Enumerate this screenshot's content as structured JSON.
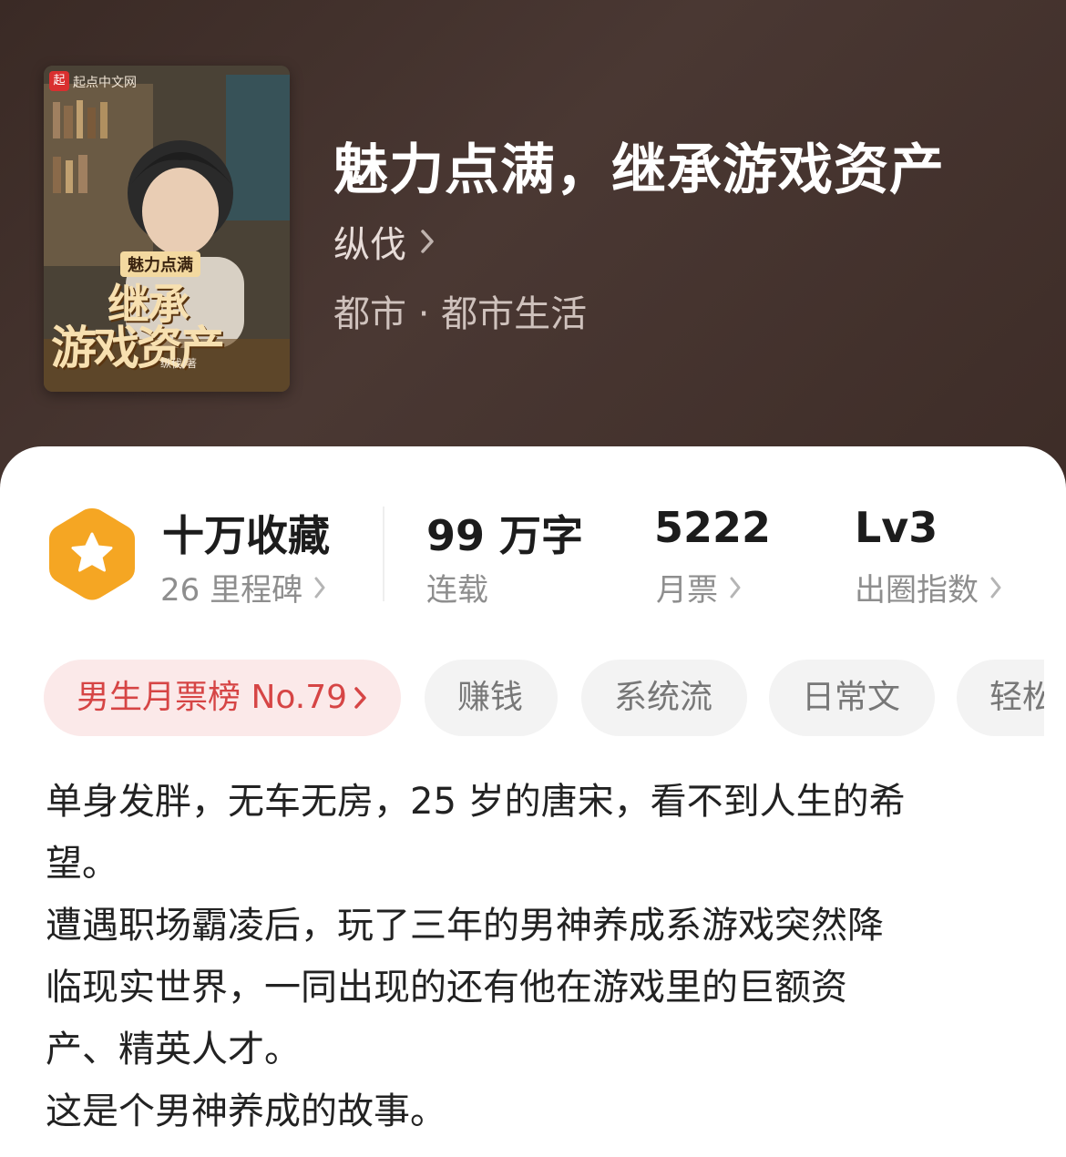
{
  "book": {
    "title": "魅力点满，继承游戏资产",
    "author": "纵伐",
    "genre": "都市 · 都市生活"
  },
  "cover": {
    "site_label": "起点中文网",
    "logo_char": "起",
    "title_small": "魅力点满",
    "title_line1": "继承",
    "title_line2": "游戏资产",
    "author_credit": "纵伐/著"
  },
  "stats": {
    "collection": {
      "value": "十万收藏",
      "sub": "26 里程碑"
    },
    "words": {
      "value": "99 万字",
      "sub": "连载"
    },
    "monthly_ticket": {
      "value": "5222",
      "sub": "月票"
    },
    "level": {
      "value": "Lv3",
      "sub": "出圈指数"
    }
  },
  "tags": [
    {
      "label": "男生月票榜 No.79"
    },
    {
      "label": "赚钱"
    },
    {
      "label": "系统流"
    },
    {
      "label": "日常文"
    },
    {
      "label": "轻松"
    }
  ],
  "description": [
    "单身发胖，无车无房，25 岁的唐宋，看不到人生的希",
    "望。",
    "遭遇职场霸凌后，玩了三年的男神养成系游戏突然降",
    "临现实世界，一同出现的还有他在游戏里的巨额资",
    "产、精英人才。",
    "这是个男神养成的故事。"
  ],
  "colors": {
    "header_bg": "#3f2e29",
    "badge_orange": "#f5a623",
    "rank_red": "#d64545"
  },
  "icons": [
    "star-badge-icon",
    "chevron-right-icon"
  ]
}
